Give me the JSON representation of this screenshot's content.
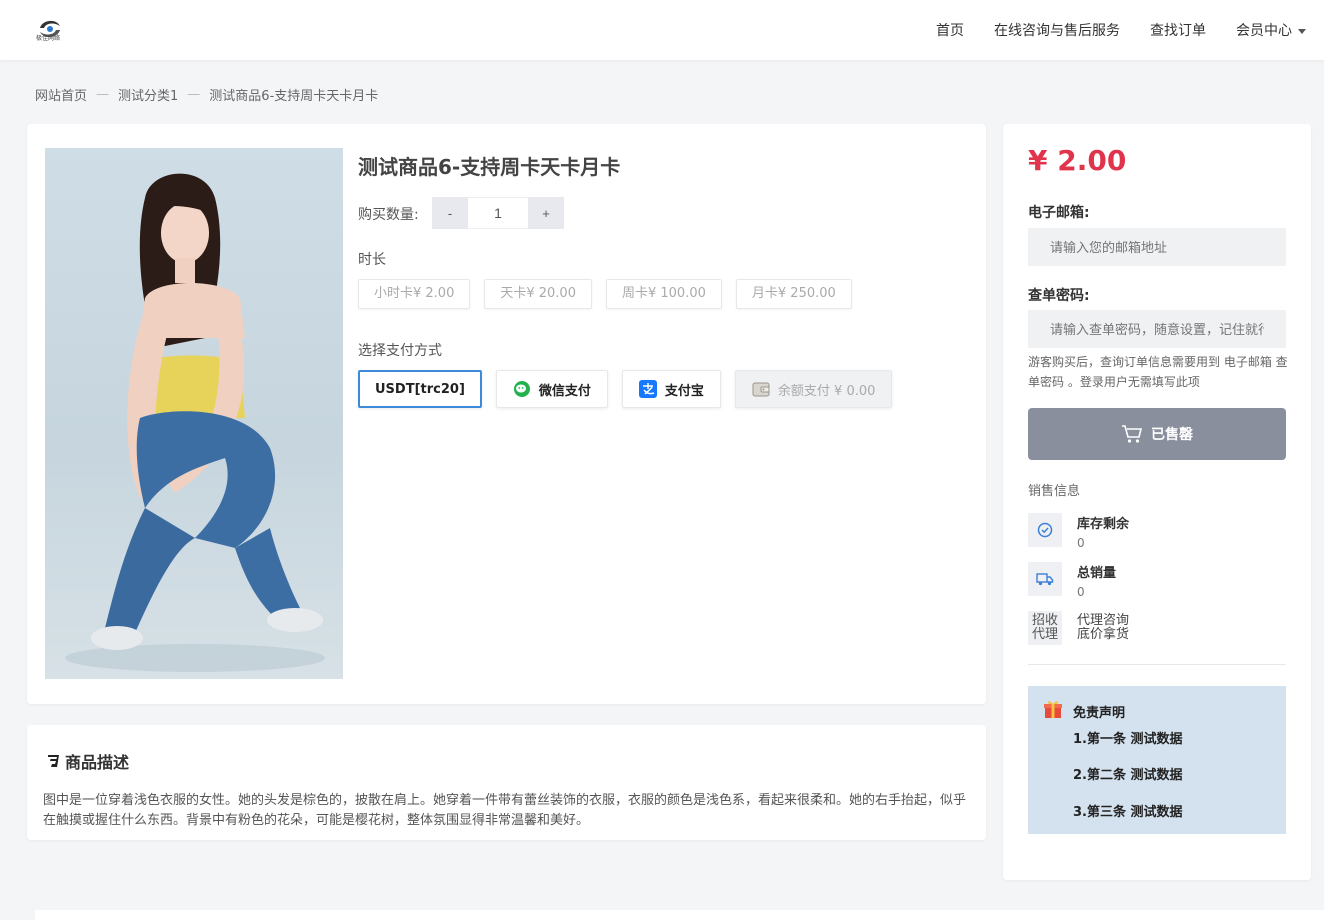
{
  "header": {
    "logo_text": "极佳网络",
    "nav": [
      {
        "label": "首页"
      },
      {
        "label": "在线咨询与售后服务"
      },
      {
        "label": "查找订单"
      },
      {
        "label": "会员中心"
      }
    ]
  },
  "breadcrumb": [
    "网站首页",
    "测试分类1",
    "测试商品6-支持周卡天卡月卡"
  ],
  "breadcrumb_sep": "—",
  "product": {
    "title": "测试商品6-支持周卡天卡月卡",
    "qty_label": "购买数量:",
    "qty_minus": "-",
    "qty_plus": "+",
    "qty_value": "1",
    "duration_label": "时长",
    "durations": [
      "小时卡¥ 2.00",
      "天卡¥ 20.00",
      "周卡¥ 100.00",
      "月卡¥ 250.00"
    ],
    "pay_label": "选择支付方式",
    "payments": [
      {
        "label": "USDT[trc20]",
        "icon": "none",
        "state": "active"
      },
      {
        "label": "微信支付",
        "icon": "wechat-icon",
        "state": "normal"
      },
      {
        "label": "支付宝",
        "icon": "alipay-icon",
        "state": "normal"
      },
      {
        "label": "余额支付 ¥ 0.00",
        "icon": "wallet-icon",
        "state": "disabled"
      }
    ]
  },
  "description": {
    "title": "商品描述",
    "text": "图中是一位穿着浅色衣服的女性。她的头发是棕色的，披散在肩上。她穿着一件带有蕾丝装饰的衣服，衣服的颜色是浅色系，看起来很柔和。她的右手抬起，似乎在触摸或握住什么东西。背景中有粉色的花朵，可能是樱花树，整体氛围显得非常温馨和美好。"
  },
  "order": {
    "price": "¥ 2.00",
    "email_label": "电子邮箱:",
    "email_placeholder": "请输入您的邮箱地址",
    "pwd_label": "查单密码:",
    "pwd_placeholder": "请输入查单密码，随意设置，记住就行",
    "hint": "游客购买后，查询订单信息需要用到 电子邮箱 查单密码 。登录用户无需填写此项",
    "buy_label": "已售罄"
  },
  "sales": {
    "title": "销售信息",
    "stock_label": "库存剩余",
    "stock_value": "0",
    "total_label": "总销量",
    "total_value": "0",
    "agent_tag_1": "招收",
    "agent_tag_2": "代理",
    "agent_text_1": "代理咨询",
    "agent_text_2": "底价拿货"
  },
  "notice": {
    "title": "免责声明",
    "items": [
      "1.第一条 测试数据",
      "2.第二条 测试数据",
      "3.第三条 测试数据"
    ]
  },
  "colors": {
    "price": "#e0344c",
    "active_border": "#3d8bd8",
    "soldout_button": "#8a8f9e",
    "notice_bg": "#d4e2ef"
  }
}
